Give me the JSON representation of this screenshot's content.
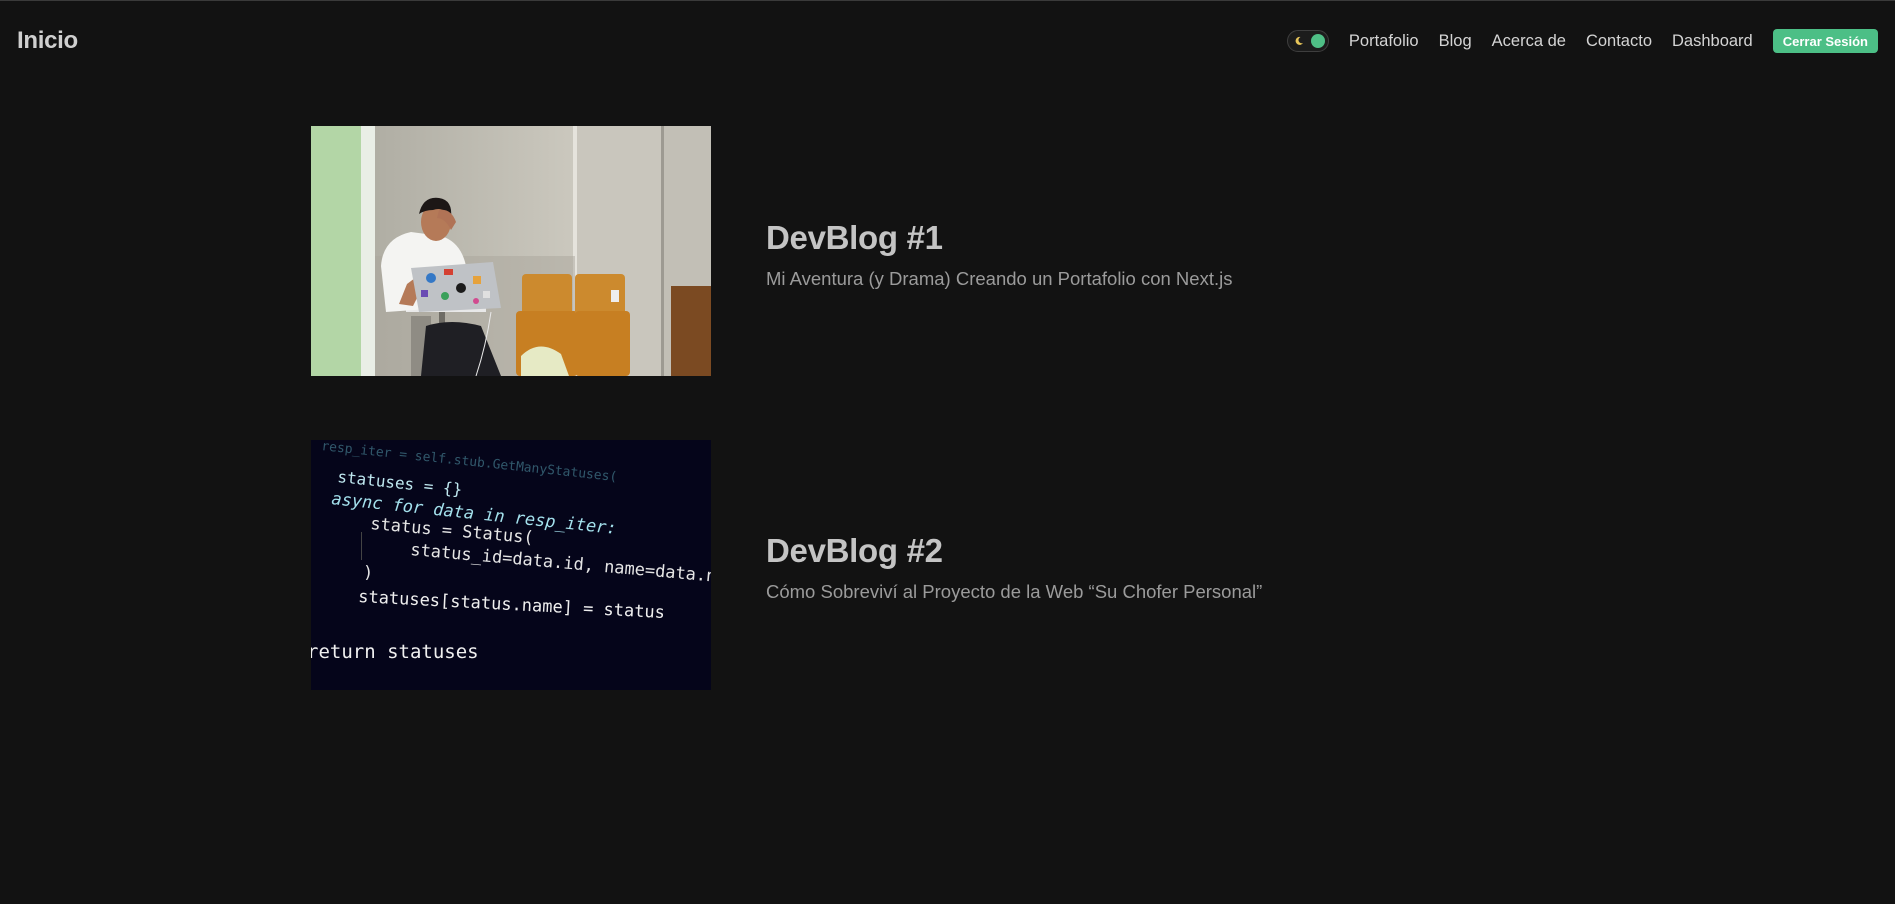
{
  "header": {
    "brand": "Inicio",
    "nav_links": [
      "Portafolio",
      "Blog",
      "Acerca de",
      "Contacto",
      "Dashboard"
    ],
    "logout_label": "Cerrar Sesión",
    "theme_toggle_icon": "moon-icon"
  },
  "posts": [
    {
      "title": "DevBlog #1",
      "subtitle": "Mi Aventura (y Drama) Creando un Portafolio con Next.js",
      "image": "stressed-developer-with-laptop-photo"
    },
    {
      "title": "DevBlog #2",
      "subtitle": "Cómo Sobreviví al Proyecto de la Web “Su Chofer Personal”",
      "image": "python-code-screen-photo",
      "code_lines": [
        "resp_iter = self.stub.GetManyStatuses(",
        "statuses = {}",
        "async for data in resp_iter:",
        "status = Status(",
        "status_id=data.id, name=data.name,",
        ")",
        "statuses[status.name] = status",
        "return statuses"
      ]
    }
  ],
  "colors": {
    "background": "#121212",
    "accent": "#4cbf86",
    "text": "#d4d4d4",
    "muted": "#9b9b9b"
  }
}
